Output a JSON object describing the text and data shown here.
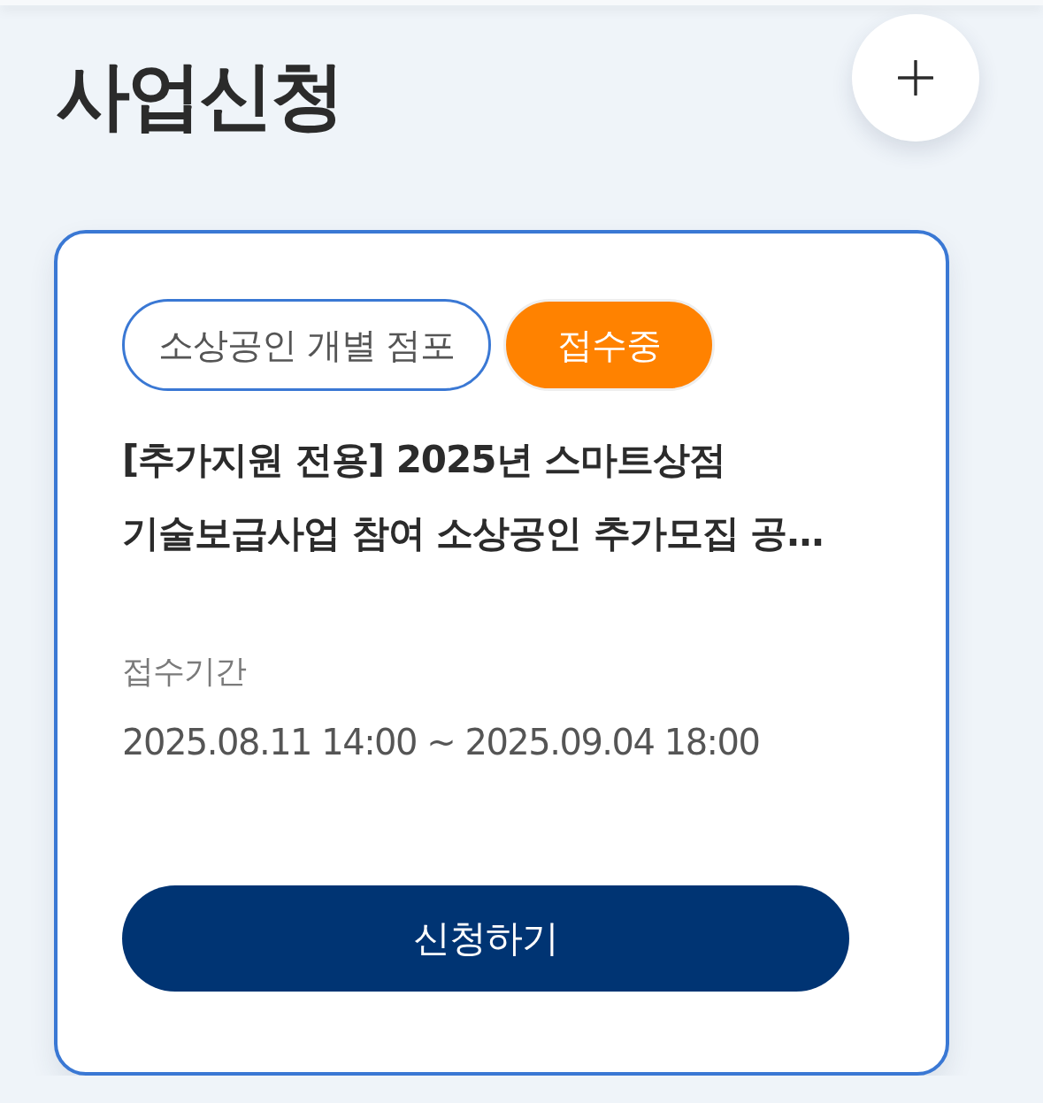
{
  "page": {
    "title": "사업신청"
  },
  "programs": [
    {
      "selected": true,
      "tags": [
        {
          "kind": "category",
          "label": "소상공인 개별 점포"
        },
        {
          "kind": "status",
          "label": "접수중"
        }
      ],
      "title": "[추가지원 전용] 2025년 스마트상점 기술보급사업 참여 소상공인 추가모집 공…",
      "period_label": "접수기간",
      "period": "2025.08.11 14:00 ~ 2025.09.04 18:00",
      "button": "신청하기"
    }
  ]
}
